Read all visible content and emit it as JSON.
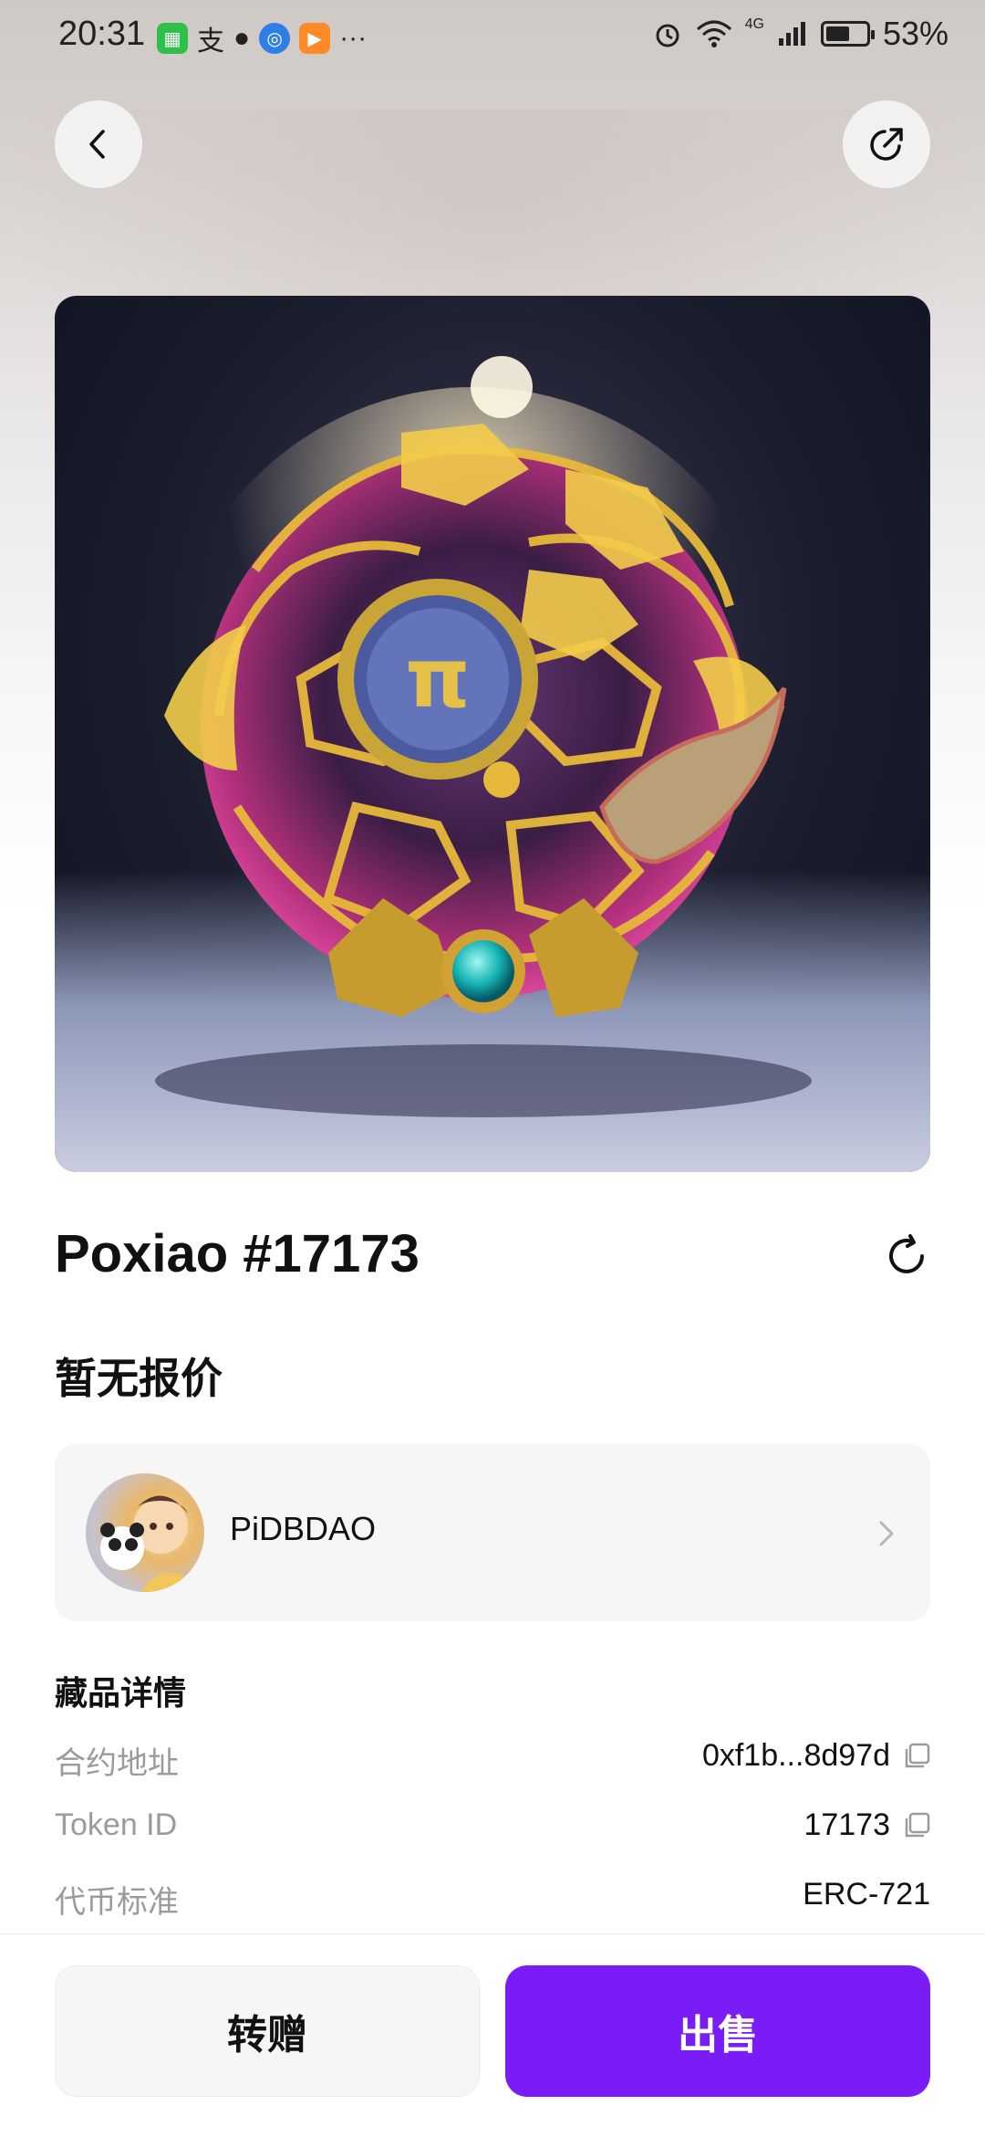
{
  "status_bar": {
    "time": "20:31",
    "battery": "53%",
    "network": "4G"
  },
  "nft": {
    "title": "Poxiao #17173",
    "price_status": "暂无报价"
  },
  "owner": {
    "name": "PiDBDAO"
  },
  "details": {
    "section_title": "藏品详情",
    "rows": [
      {
        "label": "合约地址",
        "value": "0xf1b...8d97d"
      },
      {
        "label": "Token ID",
        "value": "17173"
      },
      {
        "label": "代币标准",
        "value": "ERC-721"
      }
    ]
  },
  "actions": {
    "transfer": "转赠",
    "sell": "出售"
  },
  "colors": {
    "accent": "#7a1cf6"
  }
}
